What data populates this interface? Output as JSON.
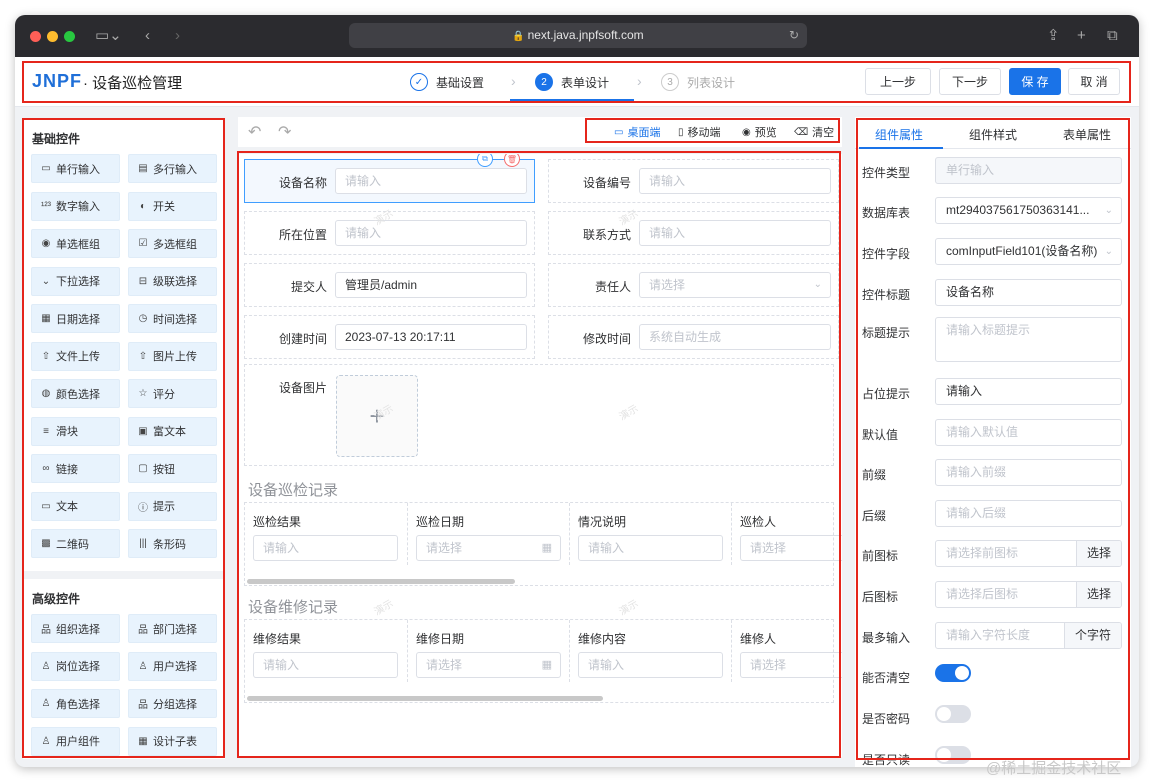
{
  "browser": {
    "url": "next.java.jnpfsoft.com"
  },
  "header": {
    "logo": "JNPF",
    "title": "· 设备巡检管理",
    "steps": [
      {
        "num": "✓",
        "label": "基础设置"
      },
      {
        "num": "2",
        "label": "表单设计"
      },
      {
        "num": "3",
        "label": "列表设计"
      }
    ],
    "buttons": {
      "prev": "上一步",
      "next": "下一步",
      "save": "保 存",
      "cancel": "取 消"
    }
  },
  "left": {
    "basic_title": "基础控件",
    "basic": [
      {
        "icon": "▭",
        "label": "单行输入"
      },
      {
        "icon": "▤",
        "label": "多行输入"
      },
      {
        "icon": "¹²³",
        "label": "数字输入"
      },
      {
        "icon": "◐",
        "label": "开关"
      },
      {
        "icon": "◉",
        "label": "单选框组"
      },
      {
        "icon": "☑",
        "label": "多选框组"
      },
      {
        "icon": "⌄",
        "label": "下拉选择"
      },
      {
        "icon": "⊟",
        "label": "级联选择"
      },
      {
        "icon": "▦",
        "label": "日期选择"
      },
      {
        "icon": "◷",
        "label": "时间选择"
      },
      {
        "icon": "⇧",
        "label": "文件上传"
      },
      {
        "icon": "⇧",
        "label": "图片上传"
      },
      {
        "icon": "◍",
        "label": "颜色选择"
      },
      {
        "icon": "☆",
        "label": "评分"
      },
      {
        "icon": "≡",
        "label": "滑块"
      },
      {
        "icon": "▣",
        "label": "富文本"
      },
      {
        "icon": "∞",
        "label": "链接"
      },
      {
        "icon": "▢",
        "label": "按钮"
      },
      {
        "icon": "▭",
        "label": "文本"
      },
      {
        "icon": "ⓘ",
        "label": "提示"
      },
      {
        "icon": "▩",
        "label": "二维码"
      },
      {
        "icon": "|||",
        "label": "条形码"
      }
    ],
    "advanced_title": "高级控件",
    "advanced": [
      {
        "icon": "品",
        "label": "组织选择"
      },
      {
        "icon": "品",
        "label": "部门选择"
      },
      {
        "icon": "♙",
        "label": "岗位选择"
      },
      {
        "icon": "♙",
        "label": "用户选择"
      },
      {
        "icon": "♙",
        "label": "角色选择"
      },
      {
        "icon": "品",
        "label": "分组选择"
      },
      {
        "icon": "♙",
        "label": "用户组件"
      },
      {
        "icon": "▦",
        "label": "设计子表"
      }
    ]
  },
  "center": {
    "toolbar": {
      "undo": "↶",
      "redo": "↷",
      "options": [
        {
          "icon": "▭",
          "label": "桌面端"
        },
        {
          "icon": "▯",
          "label": "移动端"
        },
        {
          "icon": "◉",
          "label": "预览"
        },
        {
          "icon": "⌫",
          "label": "清空"
        }
      ]
    },
    "fields": [
      {
        "label": "设备名称",
        "value": "请输入"
      },
      {
        "label": "设备编号",
        "value": "请输入"
      },
      {
        "label": "所在位置",
        "value": "请输入"
      },
      {
        "label": "联系方式",
        "value": "请输入"
      },
      {
        "label": "提交人",
        "value": "管理员/admin"
      },
      {
        "label": "责任人",
        "value": "请选择"
      },
      {
        "label": "创建时间",
        "value": "2023-07-13 20:17:11"
      },
      {
        "label": "修改时间",
        "value": "系统自动生成"
      }
    ],
    "image_label": "设备图片",
    "upload_icon": "+",
    "copy_icon": "⧉",
    "delete_icon": "🗑",
    "watermark": "演示",
    "table1": {
      "title": "设备巡检记录",
      "cols": [
        {
          "h": "巡检结果",
          "p": "请输入"
        },
        {
          "h": "巡检日期",
          "p": "请选择"
        },
        {
          "h": "情况说明",
          "p": "请输入"
        },
        {
          "h": "巡检人",
          "p": "请选择"
        }
      ]
    },
    "table2": {
      "title": "设备维修记录",
      "cols": [
        {
          "h": "维修结果",
          "p": "请输入"
        },
        {
          "h": "维修日期",
          "p": "请选择"
        },
        {
          "h": "维修内容",
          "p": "请输入"
        },
        {
          "h": "维修人",
          "p": "请选择"
        }
      ]
    }
  },
  "right": {
    "tabs": [
      "组件属性",
      "组件样式",
      "表单属性"
    ],
    "props": [
      {
        "label": "控件类型",
        "value": "单行输入"
      },
      {
        "label": "数据库表",
        "value": "mt29403756175036314​1..."
      },
      {
        "label": "控件字段",
        "value": "comInputField101(设备名称)"
      },
      {
        "label": "控件标题",
        "value": "设备名称"
      },
      {
        "label": "标题提示",
        "value": "请输入标题提示"
      },
      {
        "label": "占位提示",
        "value": "请输入"
      },
      {
        "label": "默认值",
        "value": "请输入默认值"
      },
      {
        "label": "前缀",
        "value": "请输入前缀"
      },
      {
        "label": "后缀",
        "value": "请输入后缀"
      },
      {
        "label": "前图标",
        "value": "请选择前图标",
        "append": "选择"
      },
      {
        "label": "后图标",
        "value": "请选择后图标",
        "append": "选择"
      },
      {
        "label": "最多输入",
        "value": "请输入字符长度",
        "append": "个字符"
      },
      {
        "label": "能否清空"
      },
      {
        "label": "是否密码"
      },
      {
        "label": "是否只读"
      }
    ]
  },
  "footer_mark": "@稀土掘金技术社区"
}
